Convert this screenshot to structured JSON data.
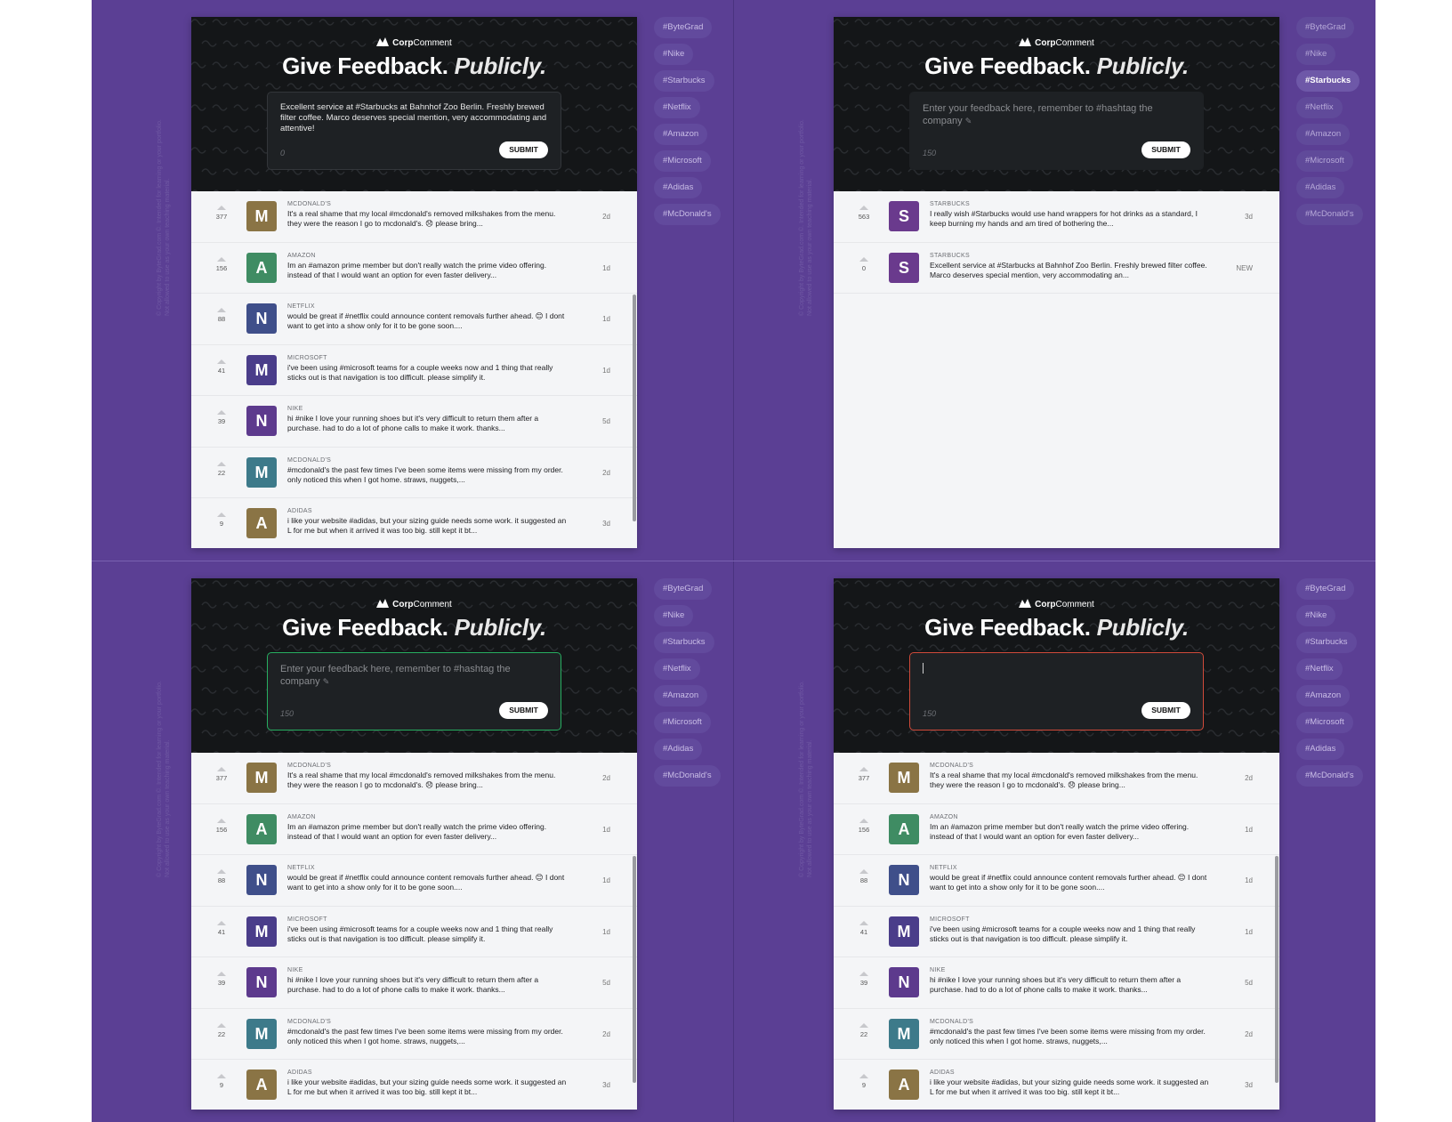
{
  "app": {
    "brand_bold": "Corp",
    "brand_rest": "Comment",
    "title_main": "Give Feedback.",
    "title_accent": "Publicly."
  },
  "copyright": {
    "line1": "© Copyright by ByteGrad.com ©. Intended for learning or your portfolio.",
    "line2": "Not allowed to use as your own teaching material."
  },
  "form": {
    "placeholder": "Enter your feedback here, remember to #hashtag the company",
    "pen_icon": "✎",
    "submit_label": "SUBMIT"
  },
  "hashtags": [
    "#ByteGrad",
    "#Nike",
    "#Starbucks",
    "#Netflix",
    "#Amazon",
    "#Microsoft",
    "#Adidas",
    "#McDonald's"
  ],
  "feedback_items": [
    {
      "upvotes": "377",
      "letter": "M",
      "company": "MCDONALD'S",
      "text": "It's a real shame that my local #mcdonald's removed milkshakes from the menu. they were the reason I go to mcdonald's. 😞 please bring...",
      "age": "2d",
      "color": "#8a7445"
    },
    {
      "upvotes": "156",
      "letter": "A",
      "company": "AMAZON",
      "text": "Im an #amazon prime member but don't really watch the prime video offering. instead of that I would want an option for even faster delivery...",
      "age": "1d",
      "color": "#3f8c63"
    },
    {
      "upvotes": "88",
      "letter": "N",
      "company": "NETFLIX",
      "text": "would be great if #netflix could announce content removals further ahead. 😊 I dont want to get into a show only for it to be gone soon....",
      "age": "1d",
      "color": "#3f4f8a"
    },
    {
      "upvotes": "41",
      "letter": "M",
      "company": "MICROSOFT",
      "text": "i've been using #microsoft teams for a couple weeks now and 1 thing that really sticks out is that navigation is too difficult. please simplify it.",
      "age": "1d",
      "color": "#4a3d8a"
    },
    {
      "upvotes": "39",
      "letter": "N",
      "company": "NIKE",
      "text": "hi #nike I love your running shoes but it's very difficult to return them after a purchase. had to do a lot of phone calls to make it work. thanks...",
      "age": "5d",
      "color": "#5d3a8d"
    },
    {
      "upvotes": "22",
      "letter": "M",
      "company": "MCDONALD'S",
      "text": "#mcdonald's the past few times I've been some items were missing from my order. only noticed this when I got home. straws, nuggets,...",
      "age": "2d",
      "color": "#3d7a8a"
    },
    {
      "upvotes": "9",
      "letter": "A",
      "company": "ADIDAS",
      "text": "i like your website #adidas, but your sizing guide needs some work. it suggested an L for me but when it arrived it was too big. still kept it bt...",
      "age": "3d",
      "color": "#8a7445"
    }
  ],
  "panel1": {
    "text": "Excellent service at #Starbucks at Bahnhof Zoo Berlin. Freshly brewed filter coffee. Marco deserves special mention, very accommodating and attentive!",
    "count": "0"
  },
  "panel2": {
    "count": "150",
    "active_tag": "#Starbucks",
    "items": [
      {
        "upvotes": "563",
        "letter": "S",
        "company": "STARBUCKS",
        "text": "I really wish #Starbucks would use hand wrappers for hot drinks as a standard, I keep burning my hands and am tired of bothering the...",
        "age": "3d",
        "color": "#6a3a8d"
      },
      {
        "upvotes": "0",
        "letter": "S",
        "company": "STARBUCKS",
        "text": "Excellent service at #Starbucks at Bahnhof Zoo Berlin. Freshly brewed filter coffee. Marco deserves special mention, very accommodating an...",
        "age": "NEW",
        "color": "#6a3a8d"
      }
    ]
  },
  "panel3": {
    "count": "150"
  },
  "panel4": {
    "count": "150"
  }
}
